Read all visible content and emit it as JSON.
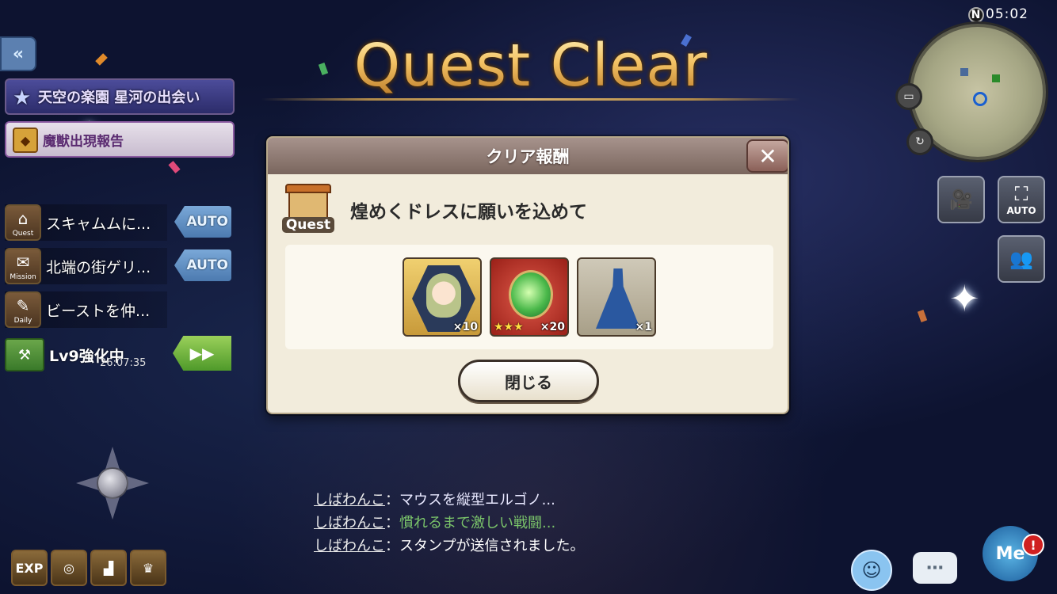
{
  "title": "Quest Clear",
  "clock": {
    "compass": "N",
    "time": "05:02"
  },
  "left_panel": {
    "back_glyph": "«",
    "quest_banner": "天空の楽園 星河の出会い",
    "mission_banner": "魔獣出現報告",
    "tasks": [
      {
        "icon_label": "Quest",
        "label": "スキャムムに...",
        "action": "AUTO"
      },
      {
        "icon_label": "Mission",
        "label": "北端の街ゲリ...",
        "action": "AUTO"
      },
      {
        "icon_label": "Daily",
        "label": "ビーストを仲..."
      }
    ],
    "enhance": {
      "label": "Lv9強化中",
      "timer": "26:07:35"
    }
  },
  "bottom_icons": [
    "EXP",
    "coin-icon",
    "boot-icon",
    "crown-icon"
  ],
  "dialog": {
    "header": "クリア報酬",
    "close_glyph": "✕",
    "quest_icon_label": "Quest",
    "quest_name": "煌めくドレスに願いを込めて",
    "rewards": [
      {
        "type": "character",
        "qty": "×10"
      },
      {
        "type": "orb",
        "stars": "★★★",
        "qty": "×20"
      },
      {
        "type": "dress",
        "qty": "×1"
      }
    ],
    "close_button": "閉じる"
  },
  "chat": [
    {
      "user": "しばわんこ",
      "sep": "：",
      "message": "マウスを縦型エルゴノ..."
    },
    {
      "user": "しばわんこ",
      "sep": "：",
      "message": "慣れるまで激しい戦闘..."
    },
    {
      "user": "しばわんこ",
      "sep": "：",
      "message": "スタンプが送信されました。"
    }
  ],
  "right_panel": {
    "auto_label": "AUTO",
    "me_label": "Me",
    "alert_glyph": "!"
  },
  "colors": {
    "title_gold": "#f3c264",
    "auto_blue": "#4c7ab0",
    "dialog_bg": "#f2ecdc"
  }
}
